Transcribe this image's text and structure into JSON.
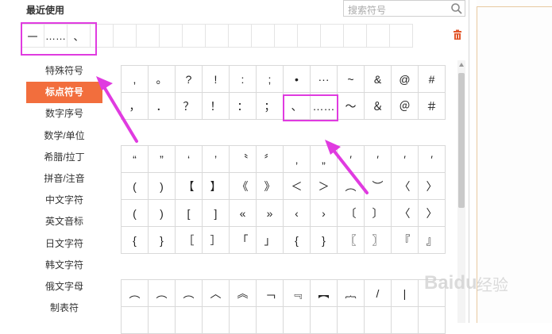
{
  "recent": {
    "title": "最近使用",
    "symbols": [
      "一",
      "……",
      "、",
      "",
      "",
      "",
      "",
      "",
      "",
      "",
      "",
      "",
      "",
      "",
      "",
      "",
      ""
    ]
  },
  "search": {
    "placeholder": "搜索符号"
  },
  "categories": [
    "特殊符号",
    "标点符号",
    "数字序号",
    "数学/单位",
    "希腊/拉丁",
    "拼音/注音",
    "中文字符",
    "英文音标",
    "日文字符",
    "韩文字符",
    "俄文字母",
    "制表符"
  ],
  "active_category": "标点符号",
  "group1": [
    [
      ",",
      "。",
      "?",
      "!",
      ":",
      ";",
      "•",
      "···",
      "~",
      "&",
      "@",
      "#"
    ],
    [
      "，",
      "．",
      "？",
      "！",
      "：",
      "；",
      "、",
      "……",
      "～",
      "＆",
      "＠",
      "＃"
    ]
  ],
  "group2": [
    [
      "“",
      "”",
      "‘",
      "’",
      "〝",
      "〞",
      "‚",
      "„",
      "′",
      "′",
      "′",
      "′"
    ],
    [
      "(",
      ")",
      "【",
      "】",
      "《",
      "》",
      "＜",
      "＞",
      "︵",
      "︶",
      "〈",
      "〉"
    ],
    [
      "(",
      ")",
      "[",
      "]",
      "«",
      "»",
      "‹",
      "›",
      "〔",
      "〕",
      "〈",
      "〉"
    ],
    [
      "{",
      "}",
      "［",
      "］",
      "「",
      "」",
      "{",
      "}",
      "〖",
      "〗",
      "『",
      "』"
    ]
  ],
  "group3": [
    [
      "︵",
      "︵",
      "︵",
      "︿",
      "︽",
      "﹁",
      "﹃",
      "︻",
      "︷",
      "/",
      "|",
      ""
    ],
    [
      "",
      "",
      "",
      "",
      "",
      "",
      "",
      "",
      "",
      "",
      "",
      ""
    ]
  ],
  "watermark": {
    "text": "Baidu",
    "sub": "经验"
  },
  "colors": {
    "accent": "#f26e3d",
    "highlight": "#e03be0"
  }
}
